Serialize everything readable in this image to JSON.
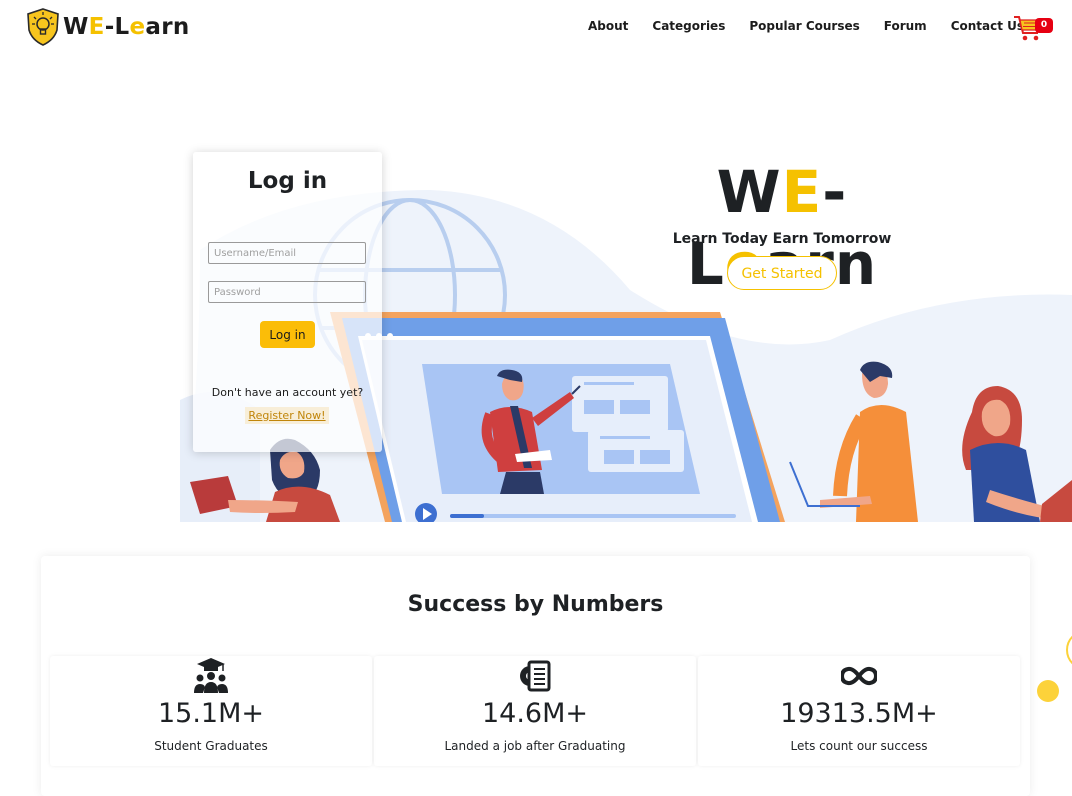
{
  "brand": {
    "name_prefix": "W",
    "name_e": "E",
    "name_mid": "-L",
    "name_e2": "e",
    "name_suffix": "arn"
  },
  "nav": {
    "items": [
      "About",
      "Categories",
      "Popular Courses",
      "Forum",
      "Contact Us"
    ]
  },
  "cart": {
    "count": "0"
  },
  "hero": {
    "title_w": "W",
    "title_e": "E",
    "title_mid": "-L",
    "title_e2": "e",
    "title_rest": "arn",
    "subtitle": "Learn Today Earn Tomorrow",
    "cta": "Get Started"
  },
  "login": {
    "title": "Log in",
    "username_placeholder": "Username/Email",
    "password_placeholder": "Password",
    "button": "Log in",
    "no_account": "Don't have an account yet?",
    "register": "Register Now!"
  },
  "stats": {
    "title": "Success by Numbers",
    "items": [
      {
        "value": "15.1M+",
        "label": "Student Graduates",
        "icon": "graduates-icon"
      },
      {
        "value": "14.6M+",
        "label": "Landed a job after Graduating",
        "icon": "job-icon"
      },
      {
        "value": "19313.5M+",
        "label": "Lets count our success",
        "icon": "infinity-icon"
      }
    ]
  },
  "colors": {
    "accent": "#f5c100",
    "button": "#fbbd08",
    "badge": "#e60012",
    "illustration_blue": "#6c9ef0"
  }
}
